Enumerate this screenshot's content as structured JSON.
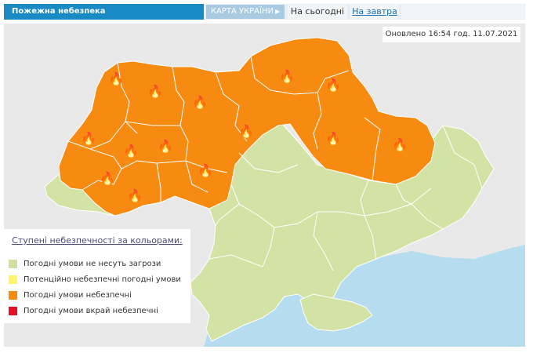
{
  "header": {
    "title": "Пожежна небезпека",
    "map_tab": "КАРТА УКРАЇНИ",
    "today_tab": "На сьогодні",
    "tomorrow_tab": "На завтра"
  },
  "updated_text": "Оновлено 16:54 год. 11.07.2021",
  "legend": {
    "title": "Ступені небезпечності за кольорами:",
    "items": [
      {
        "label": "Погодні умови не несуть загрози",
        "color": "#cfe0a0"
      },
      {
        "label": "Потенційно небезпечні погодні умови",
        "color": "#fff36a"
      },
      {
        "label": "Погодні умови небезпечні",
        "color": "#f78b12"
      },
      {
        "label": "Погодні умови вкрай небезпечні",
        "color": "#e50f26"
      }
    ]
  },
  "colors": {
    "danger": "#f78b12",
    "safe": "#d3e3a5",
    "sea": "#b5dcef",
    "border": "#ffffff"
  },
  "icons": {
    "fire": "fire-icon"
  }
}
